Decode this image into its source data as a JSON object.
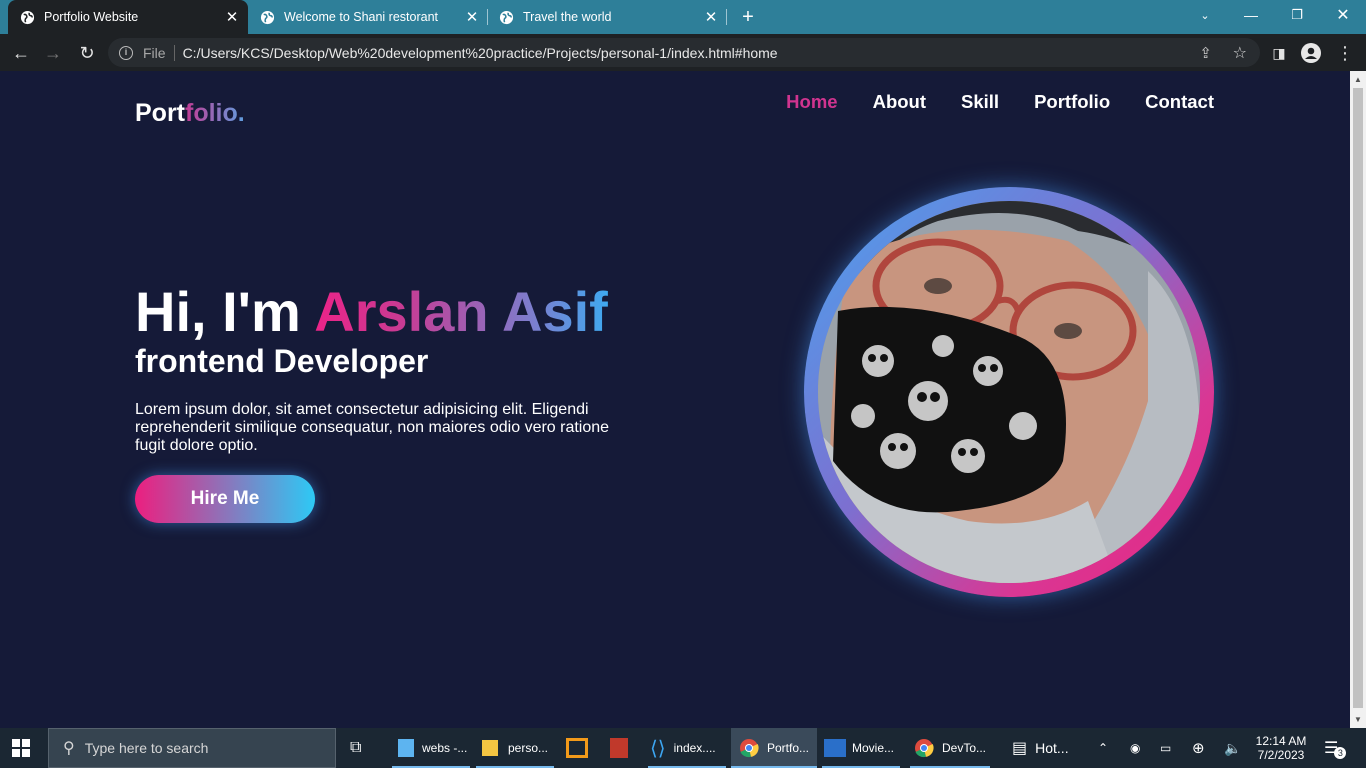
{
  "browser": {
    "tabs": [
      {
        "title": "Portfolio Website",
        "active": true
      },
      {
        "title": "Welcome to Shani restorant",
        "active": false
      },
      {
        "title": "Travel the world",
        "active": false
      }
    ],
    "new_tab": "+",
    "address": {
      "scheme_label": "File",
      "url": "C:/Users/KCS/Desktop/Web%20development%20practice/Projects/personal-1/index.html#home"
    }
  },
  "site": {
    "logo_main": "Port",
    "logo_accent": "folio.",
    "nav": [
      {
        "label": "Home",
        "active": true
      },
      {
        "label": "About",
        "active": false
      },
      {
        "label": "Skill",
        "active": false
      },
      {
        "label": "Portfolio",
        "active": false
      },
      {
        "label": "Contact",
        "active": false
      }
    ],
    "hero": {
      "greeting": "Hi, I'm ",
      "name": "Arslan Asif",
      "role": "frontend Developer",
      "description": "Lorem ipsum dolor, sit amet consectetur adipisicing elit. Eligendi reprehenderit similique consequatur, non maiores odio vero ratione fugit dolore optio.",
      "cta": "Hire Me"
    },
    "accent_colors": {
      "pink": "#ec1f7f",
      "blue": "#2dc9f5",
      "bg": "#151a38"
    }
  },
  "taskbar": {
    "search_placeholder": "Type here to search",
    "items": [
      {
        "label": "webs -...",
        "icon": "cube-icon"
      },
      {
        "label": "perso...",
        "icon": "folder-icon"
      },
      {
        "label": "",
        "icon": "vmware-icon"
      },
      {
        "label": "",
        "icon": "app-icon"
      },
      {
        "label": "index....",
        "icon": "vscode-icon"
      },
      {
        "label": "Portfo...",
        "icon": "chrome-icon"
      },
      {
        "label": "Movie...",
        "icon": "movie-icon"
      },
      {
        "label": "DevTo...",
        "icon": "chrome-icon"
      },
      {
        "label": "Hot...",
        "icon": "news-icon"
      }
    ],
    "time": "12:14 AM",
    "date": "7/2/2023",
    "notifications": "3"
  }
}
